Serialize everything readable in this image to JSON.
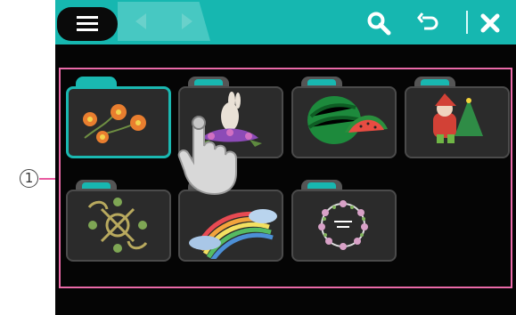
{
  "callout_number": "1",
  "toolbar": {
    "menu_icon": "hamburger-menu-icon",
    "prev_icon": "chevron-left-icon",
    "next_icon": "chevron-right-icon",
    "search_icon": "magnifier-icon",
    "undo_icon": "undo-icon",
    "close_icon": "close-icon"
  },
  "folders": [
    {
      "name": "flowers",
      "selected": true
    },
    {
      "name": "rabbit",
      "selected": false
    },
    {
      "name": "watermelon",
      "selected": false
    },
    {
      "name": "santa",
      "selected": false
    },
    {
      "name": "ornament",
      "selected": false
    },
    {
      "name": "rainbow",
      "selected": false
    },
    {
      "name": "wreath",
      "selected": false
    }
  ],
  "colors": {
    "teal": "#16b7b0",
    "frame_pink": "#ea6aa8",
    "folder_gray": "#2b2b2b"
  }
}
